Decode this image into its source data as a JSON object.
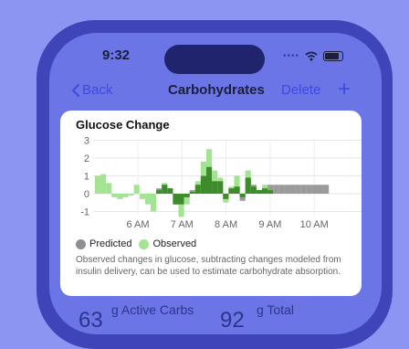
{
  "status": {
    "time": "9:32"
  },
  "nav": {
    "back_label": "Back",
    "title": "Carbohydrates",
    "delete_label": "Delete",
    "add_label": "+"
  },
  "card": {
    "title": "Glucose Change",
    "description": "Observed changes in glucose, subtracting changes modeled from insulin delivery, can be used to estimate carbohydrate absorption."
  },
  "legend": [
    {
      "label": "Predicted",
      "color": "#8e8e93"
    },
    {
      "label": "Observed",
      "color": "#a3e492"
    }
  ],
  "footer": {
    "active_value": "63",
    "active_label": "g Active Carbs",
    "total_value": "92",
    "total_label": "g Total"
  },
  "chart_data": {
    "type": "bar",
    "title": "Glucose Change",
    "y_ticks": [
      "3",
      "2",
      "1",
      "0",
      "-1"
    ],
    "ylim": [
      -1.2,
      3
    ],
    "x_ticks": [
      "6 AM",
      "7 AM",
      "8 AM",
      "9 AM",
      "10 AM"
    ],
    "grid": true,
    "colors": {
      "observed": "#a3e492",
      "overlap": "#3d8b2b",
      "predicted": "#9a9a9a"
    },
    "series": [
      {
        "name": "Observed",
        "values": [
          1.0,
          1.1,
          0.6,
          -0.2,
          -0.3,
          -0.2,
          -0.1,
          0.5,
          -0.3,
          -0.6,
          -1.0,
          0.2,
          0.6,
          0.3,
          -0.6,
          -1.3,
          -0.6,
          0.1,
          0.7,
          1.8,
          2.5,
          1.3,
          0.9,
          -0.5,
          0.4,
          1.0,
          -0.2,
          1.3,
          0.4,
          0.2,
          0.5,
          0.2
        ]
      },
      {
        "name": "Predicted",
        "values": [
          0,
          0,
          0,
          0,
          0,
          0,
          0,
          0,
          0,
          0,
          0,
          0.3,
          0.5,
          0.3,
          -0.6,
          -0.6,
          -0.2,
          0.2,
          0.5,
          1.0,
          1.5,
          0.7,
          0.7,
          -0.3,
          0.3,
          0.4,
          -0.4,
          0.9,
          0.5,
          0.2,
          0.3,
          0.5,
          0.5,
          0.5,
          0.5,
          0.5,
          0.5,
          0.5,
          0.5,
          0.5,
          0.5,
          0.5
        ]
      }
    ]
  }
}
